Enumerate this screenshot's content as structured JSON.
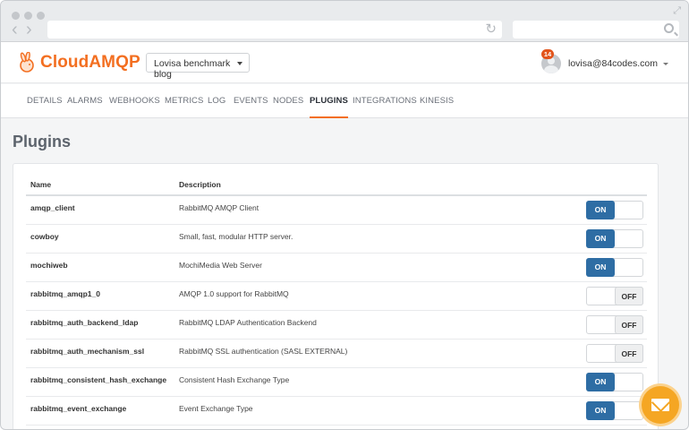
{
  "browser": {
    "back_icon": "chevron-left-icon",
    "forward_icon": "chevron-right-icon",
    "reload_icon": "reload-icon",
    "search_icon": "search-icon",
    "expand_icon": "expand-icon"
  },
  "header": {
    "logo_text": "CloudAMQP",
    "instance_selected": "Lovisa benchmark blog",
    "notification_count": "14",
    "user_email": "lovisa@84codes.com"
  },
  "tabs": [
    {
      "label": "DETAILS"
    },
    {
      "label": "ALARMS"
    },
    {
      "label": "WEBHOOKS"
    },
    {
      "label": "METRICS"
    },
    {
      "label": "LOG"
    },
    {
      "label": "EVENTS"
    },
    {
      "label": "NODES"
    },
    {
      "label": "PLUGINS"
    },
    {
      "label": "INTEGRATIONS"
    },
    {
      "label": "KINESIS"
    }
  ],
  "active_tab": "PLUGINS",
  "page": {
    "title": "Plugins"
  },
  "table": {
    "columns": {
      "name": "Name",
      "description": "Description"
    },
    "rows": [
      {
        "name": "amqp_client",
        "description": "RabbitMQ AMQP Client",
        "state": "ON"
      },
      {
        "name": "cowboy",
        "description": "Small, fast, modular HTTP server.",
        "state": "ON"
      },
      {
        "name": "mochiweb",
        "description": "MochiMedia Web Server",
        "state": "ON"
      },
      {
        "name": "rabbitmq_amqp1_0",
        "description": "AMQP 1.0 support for RabbitMQ",
        "state": "OFF"
      },
      {
        "name": "rabbitmq_auth_backend_ldap",
        "description": "RabbitMQ LDAP Authentication Backend",
        "state": "OFF"
      },
      {
        "name": "rabbitmq_auth_mechanism_ssl",
        "description": "RabbitMQ SSL authentication (SASL EXTERNAL)",
        "state": "OFF"
      },
      {
        "name": "rabbitmq_consistent_hash_exchange",
        "description": "Consistent Hash Exchange Type",
        "state": "ON"
      },
      {
        "name": "rabbitmq_event_exchange",
        "description": "Event Exchange Type",
        "state": "ON"
      }
    ]
  },
  "colors": {
    "brand": "#f36f21",
    "toggle_on": "#2e6da4",
    "chat": "#f5a623"
  },
  "chat": {
    "icon": "envelope-icon"
  }
}
